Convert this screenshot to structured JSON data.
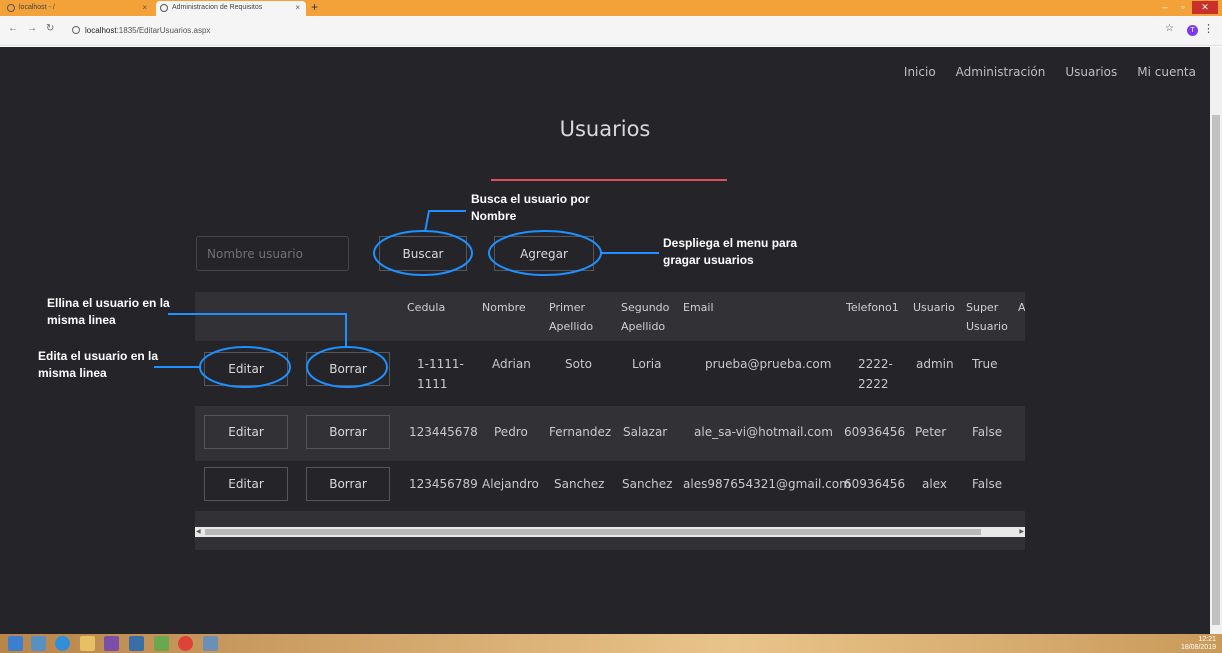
{
  "browser": {
    "tabs": [
      {
        "label": "localhost - /",
        "active": false
      },
      {
        "label": "Administracion de Requisitos",
        "active": true
      }
    ],
    "new_tab": "+",
    "url_host": "localhost",
    "url_path": ":1835/EditarUsuarios.aspx",
    "profile_initial": "T",
    "tab_close": "×"
  },
  "nav": {
    "items": [
      "Inicio",
      "Administración",
      "Usuarios",
      "Mi cuenta"
    ]
  },
  "page": {
    "title": "Usuarios",
    "accent_color": "#e04e5a",
    "search_placeholder": "Nombre usuario",
    "buscar_label": "Buscar",
    "agregar_label": "Agregar"
  },
  "table": {
    "headers": {
      "cedula": "Cedula",
      "nombre": "Nombre",
      "primer_1": "Primer",
      "primer_2": "Apellido",
      "segundo_1": "Segundo",
      "segundo_2": "Apellido",
      "email": "Email",
      "telefono": "Telefono1",
      "usuario": "Usuario",
      "super_1": "Super",
      "super_2": "Usuario",
      "extra": "A"
    },
    "edit_label": "Editar",
    "delete_label": "Borrar",
    "rows": [
      {
        "cedula_1": "1-1111-",
        "cedula_2": "1111",
        "nombre": "Adrian",
        "primer": "Soto",
        "segundo": "Loria",
        "email": "prueba@prueba.com",
        "tel_1": "2222-",
        "tel_2": "2222",
        "usuario": "admin",
        "super": "True"
      },
      {
        "cedula": "123445678",
        "nombre": "Pedro",
        "primer": "Fernandez",
        "segundo": "Salazar",
        "email": "ale_sa-vi@hotmail.com",
        "tel": "60936456",
        "usuario": "Peter",
        "super": "False"
      },
      {
        "cedula": "123456789",
        "nombre": "Alejandro",
        "primer": "Sanchez",
        "segundo": "Sanchez",
        "email": "ales987654321@gmail.com",
        "tel": "60936456",
        "usuario": "alex",
        "super": "False"
      }
    ]
  },
  "annotations": {
    "buscar_1": "Busca el usuario por",
    "buscar_2": "Nombre",
    "agregar_1": "Despliega el menu para",
    "agregar_2": "gragar usuarios",
    "borrar_1": "Ellina el usuario en la",
    "borrar_2": "misma linea",
    "editar_1": "Edita el usuario en la",
    "editar_2": "misma linea",
    "circle_color": "#1e90ff"
  },
  "taskbar": {
    "time": "12:21",
    "date": "18/08/2019"
  }
}
